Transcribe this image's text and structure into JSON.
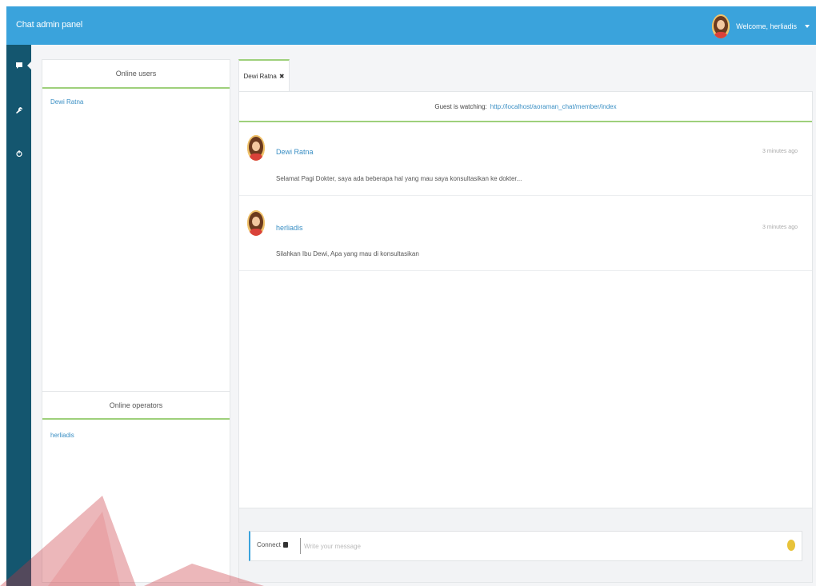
{
  "topbar": {
    "brand": "Chat admin panel",
    "welcome": "Welcome, herliadis"
  },
  "sidebar": {
    "items": [
      {
        "icon": "chat-bubble-icon",
        "active": true
      },
      {
        "icon": "wrench-icon",
        "active": false
      },
      {
        "icon": "power-icon",
        "active": false
      }
    ]
  },
  "left_panel": {
    "online_users_title": "Online users",
    "online_users": [
      "Dewi Ratna"
    ],
    "online_operators_title": "Online operators",
    "online_operators": [
      "herliadis"
    ]
  },
  "tab": {
    "label": "Dewi Ratna",
    "close": "✖"
  },
  "chat": {
    "watching_label": "Guest is watching:",
    "watching_url": "http://localhost/aoraman_chat/member/index",
    "messages": [
      {
        "name": "Dewi Ratna",
        "time": "3 minutes ago",
        "text": "Selamat Pagi Dokter, saya ada beberapa hal yang mau saya konsultasikan ke dokter..."
      },
      {
        "name": "herliadis",
        "time": "3 minutes ago",
        "text": "Silahkan Ibu Dewi, Apa yang mau di konsultasikan"
      }
    ]
  },
  "composer": {
    "send_label": "Connect",
    "placeholder": "Write your message"
  },
  "colors": {
    "topbar": "#3aa3dc",
    "sidebar": "#14566f",
    "accent_green": "#9ed07b",
    "link_blue": "#3a8fc4"
  }
}
